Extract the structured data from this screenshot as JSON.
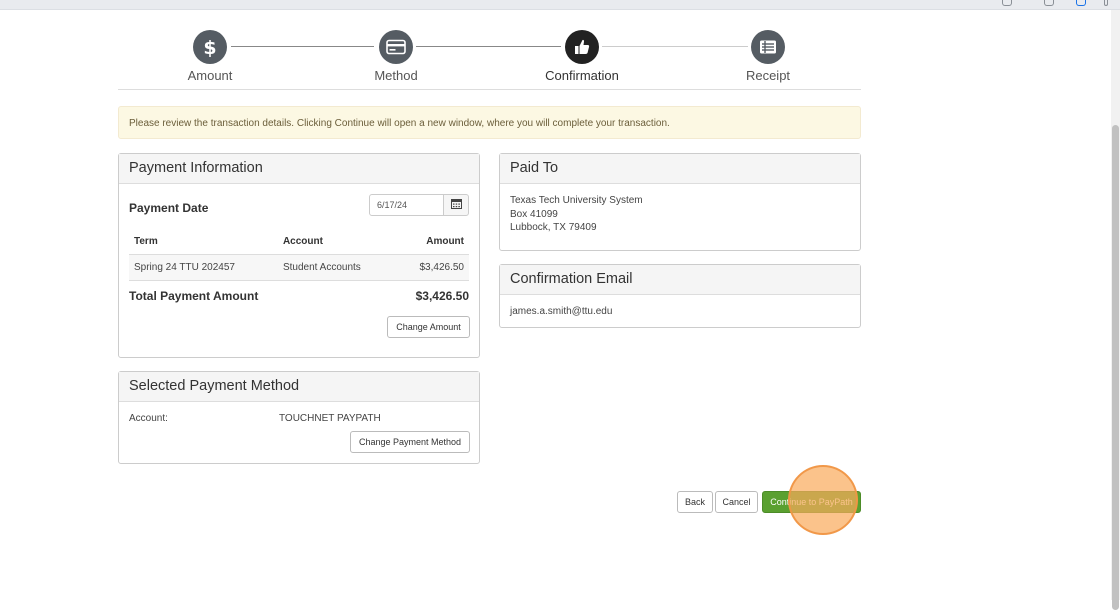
{
  "steps": [
    {
      "label": "Amount",
      "icon": "dollar-icon"
    },
    {
      "label": "Method",
      "icon": "card-icon"
    },
    {
      "label": "Confirmation",
      "icon": "thumbs-up-icon"
    },
    {
      "label": "Receipt",
      "icon": "list-icon"
    }
  ],
  "active_step": "Confirmation",
  "notice": "Please review the transaction details. Clicking Continue will open a new window, where you will complete your transaction.",
  "payment_info": {
    "title": "Payment Information",
    "date_label": "Payment Date",
    "date_value": "6/17/24",
    "columns": [
      "Term",
      "Account",
      "Amount"
    ],
    "rows": [
      {
        "term": "Spring 24 TTU 202457",
        "account": "Student Accounts",
        "amount": "$3,426.50"
      }
    ],
    "total_label": "Total Payment Amount",
    "total_value": "$3,426.50",
    "change_amount_label": "Change Amount"
  },
  "payment_method": {
    "title": "Selected Payment Method",
    "account_label": "Account:",
    "account_value": "TOUCHNET PAYPATH",
    "change_label": "Change Payment Method"
  },
  "paid_to": {
    "title": "Paid To",
    "line1": "Texas Tech University System",
    "line2": "Box 41099",
    "line3": "Lubbock, TX 79409"
  },
  "confirmation_email": {
    "title": "Confirmation Email",
    "email": "james.a.smith@ttu.edu"
  },
  "actions": {
    "back": "Back",
    "cancel": "Cancel",
    "continue": "Continue to PayPath"
  },
  "colors": {
    "primary_button": "#5aa030",
    "notice_bg": "#fcf8e3",
    "active_step": "#222222",
    "click_highlight": "#f5a55a"
  }
}
